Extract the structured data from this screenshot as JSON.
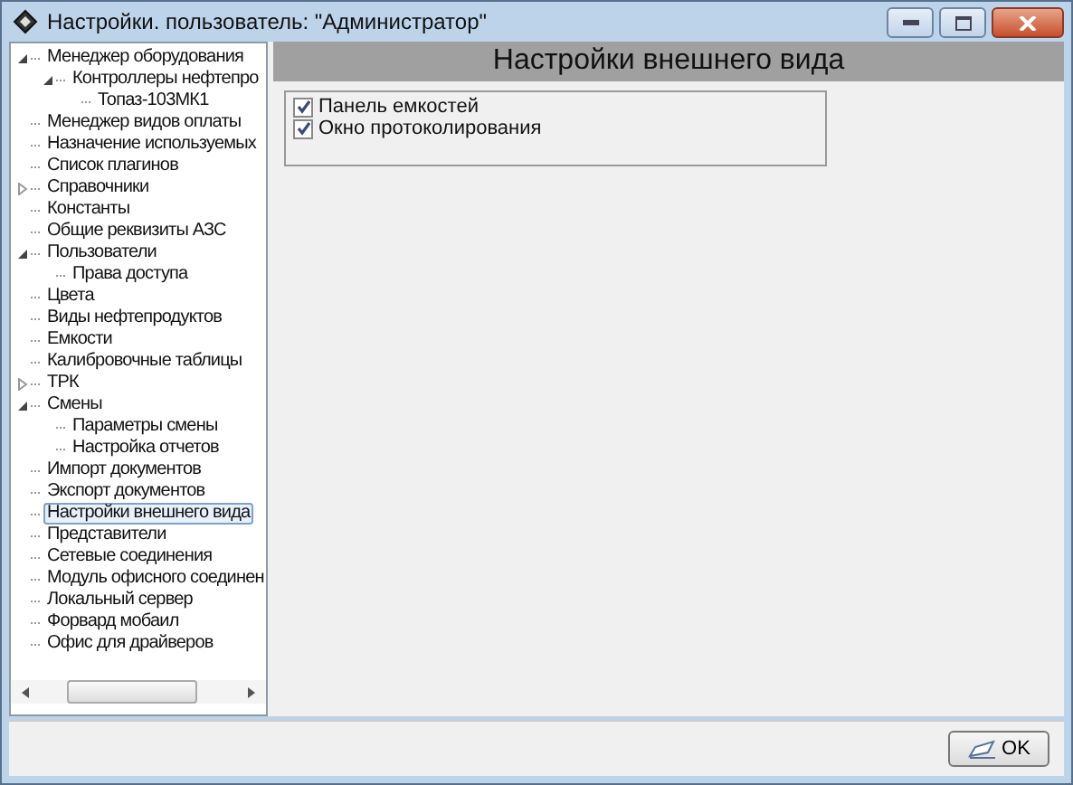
{
  "window": {
    "title": "Настройки. пользователь: \"Администратор\""
  },
  "tree": [
    {
      "label": "Менеджер оборудования",
      "expanded": true,
      "selected": false,
      "children": [
        {
          "label": "Контроллеры нефтепро",
          "expanded": true,
          "selected": false,
          "children": [
            {
              "label": "Топаз-103МК1",
              "selected": false
            }
          ]
        }
      ]
    },
    {
      "label": "Менеджер видов оплаты",
      "selected": false
    },
    {
      "label": "Назначение используемых",
      "selected": false
    },
    {
      "label": "Список плагинов",
      "selected": false
    },
    {
      "label": "Справочники",
      "expanded": false,
      "selected": false
    },
    {
      "label": "Константы",
      "selected": false
    },
    {
      "label": "Общие реквизиты АЗС",
      "selected": false
    },
    {
      "label": "Пользователи",
      "expanded": true,
      "selected": false,
      "children": [
        {
          "label": "Права доступа",
          "selected": false
        }
      ]
    },
    {
      "label": "Цвета",
      "selected": false
    },
    {
      "label": "Виды нефтепродуктов",
      "selected": false
    },
    {
      "label": "Емкости",
      "selected": false
    },
    {
      "label": "Калибровочные таблицы",
      "selected": false
    },
    {
      "label": "ТРК",
      "expanded": false,
      "selected": false
    },
    {
      "label": "Смены",
      "expanded": true,
      "selected": false,
      "children": [
        {
          "label": "Параметры смены",
          "selected": false
        },
        {
          "label": "Настройка отчетов",
          "selected": false
        }
      ]
    },
    {
      "label": "Импорт документов",
      "selected": false
    },
    {
      "label": "Экспорт документов",
      "selected": false
    },
    {
      "label": "Настройки внешнего вида",
      "selected": true
    },
    {
      "label": "Представители",
      "selected": false
    },
    {
      "label": "Сетевые соединения",
      "selected": false
    },
    {
      "label": "Модуль офисного соединен",
      "selected": false
    },
    {
      "label": "Локальный сервер",
      "selected": false
    },
    {
      "label": "Форвард мобаил",
      "selected": false
    },
    {
      "label": "Офис для драйверов",
      "selected": false
    }
  ],
  "panel": {
    "title": "Настройки внешнего вида",
    "options": [
      {
        "label": "Панель емкостей",
        "checked": true
      },
      {
        "label": "Окно протоколирования",
        "checked": true
      }
    ]
  },
  "buttons": [
    {
      "label": "OK"
    }
  ]
}
